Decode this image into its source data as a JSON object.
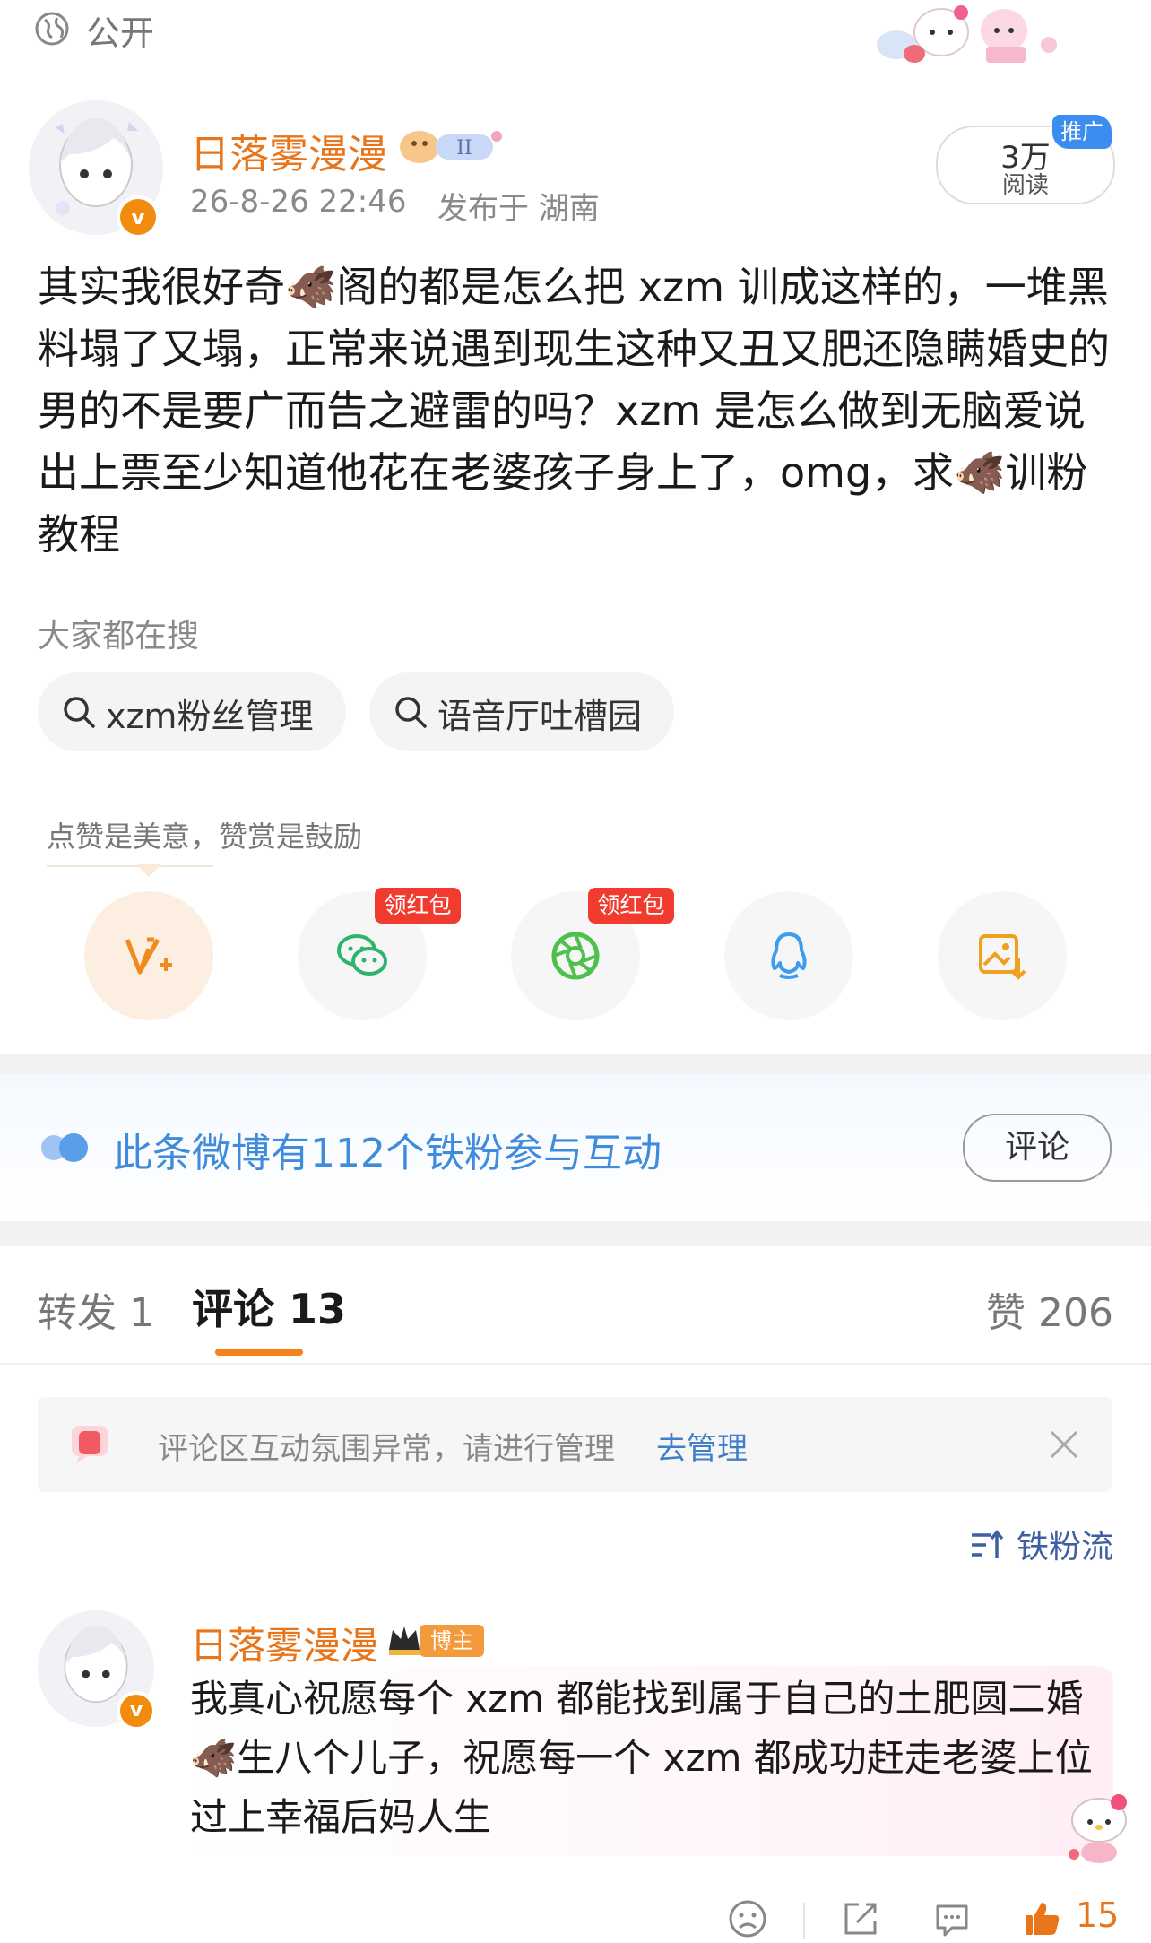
{
  "visibility": {
    "label": "公开",
    "icon": "globe-icon"
  },
  "author": {
    "name": "日落雾漫漫",
    "time": "26-8-26 22:46",
    "location": "发布于 湖南",
    "verified_badge": "v",
    "medal": "II"
  },
  "reads": {
    "count": "3万",
    "label": "阅读",
    "promo_tag": "推广"
  },
  "post": {
    "text": "其实我很好奇🐗阁的都是怎么把 xzm 训成这样的，一堆黑料塌了又塌，正常来说遇到现生这种又丑又肥还隐瞒婚史的男的不是要广而告之避雷的吗？xzm 是怎么做到无脑爱说出上票至少知道他花在老婆孩子身上了，omg，求🐗训粉教程"
  },
  "hot_search": {
    "title": "大家都在搜",
    "items": [
      {
        "label": "xzm粉丝管理"
      },
      {
        "label": "语音厅吐槽园"
      }
    ]
  },
  "tip": {
    "text": "点赞是美意，赞赏是鼓励"
  },
  "share": {
    "red_packet_label": "领红包",
    "items": [
      "reward-icon",
      "wechat-icon",
      "moments-icon",
      "qq-icon",
      "save-image-icon"
    ]
  },
  "fans_banner": {
    "text": "此条微博有112个铁粉参与互动",
    "button": "评论"
  },
  "tabs": {
    "repost": "转发 1",
    "comment": "评论 13",
    "like": "赞 206"
  },
  "notice": {
    "text": "评论区互动氛围异常，请进行管理",
    "link": "去管理"
  },
  "sort": {
    "label": "铁粉流"
  },
  "comment": {
    "name": "日落雾漫漫",
    "tag": "博主",
    "verified_badge": "v",
    "text": "我真心祝愿每个 xzm 都能找到属于自己的土肥圆二婚🐗生八个儿子，祝愿每一个 xzm 都成功赶走老婆上位过上幸福后妈人生",
    "like_count": "15"
  },
  "colors": {
    "accent": "#e8751a",
    "link": "#3f8bdc",
    "promo": "#3b8ef0",
    "red": "#f13b2f"
  }
}
